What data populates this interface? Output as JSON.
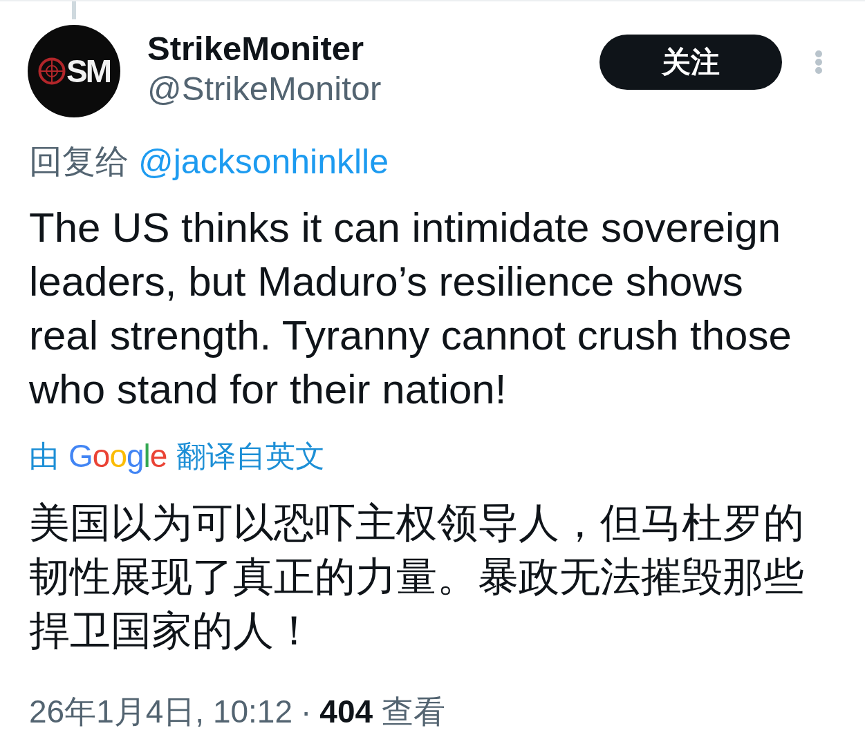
{
  "author": {
    "avatar_text": "SM",
    "name": "StrikeMoniter",
    "handle": "@StrikeMonitor"
  },
  "follow_button": {
    "label": "关注"
  },
  "reply_to": {
    "label": "回复给",
    "handle": "@jacksonhinklle"
  },
  "text": "The US thinks it can intimidate sovereign leaders, but Maduro’s resilience shows real strength. Tyranny cannot crush those who stand for their nation!",
  "translation": {
    "prefix": "由",
    "provider": "Google",
    "suffix": "翻译自英文",
    "text": "美国以为可以恐吓主权领导人，但马杜罗的韧性展现了真正的力量。暴政无法摧毁那些捍卫国家的人！"
  },
  "meta": {
    "timestamp": "26年1月4日, 10:12",
    "separator": "·",
    "views": "**404** 查看"
  }
}
